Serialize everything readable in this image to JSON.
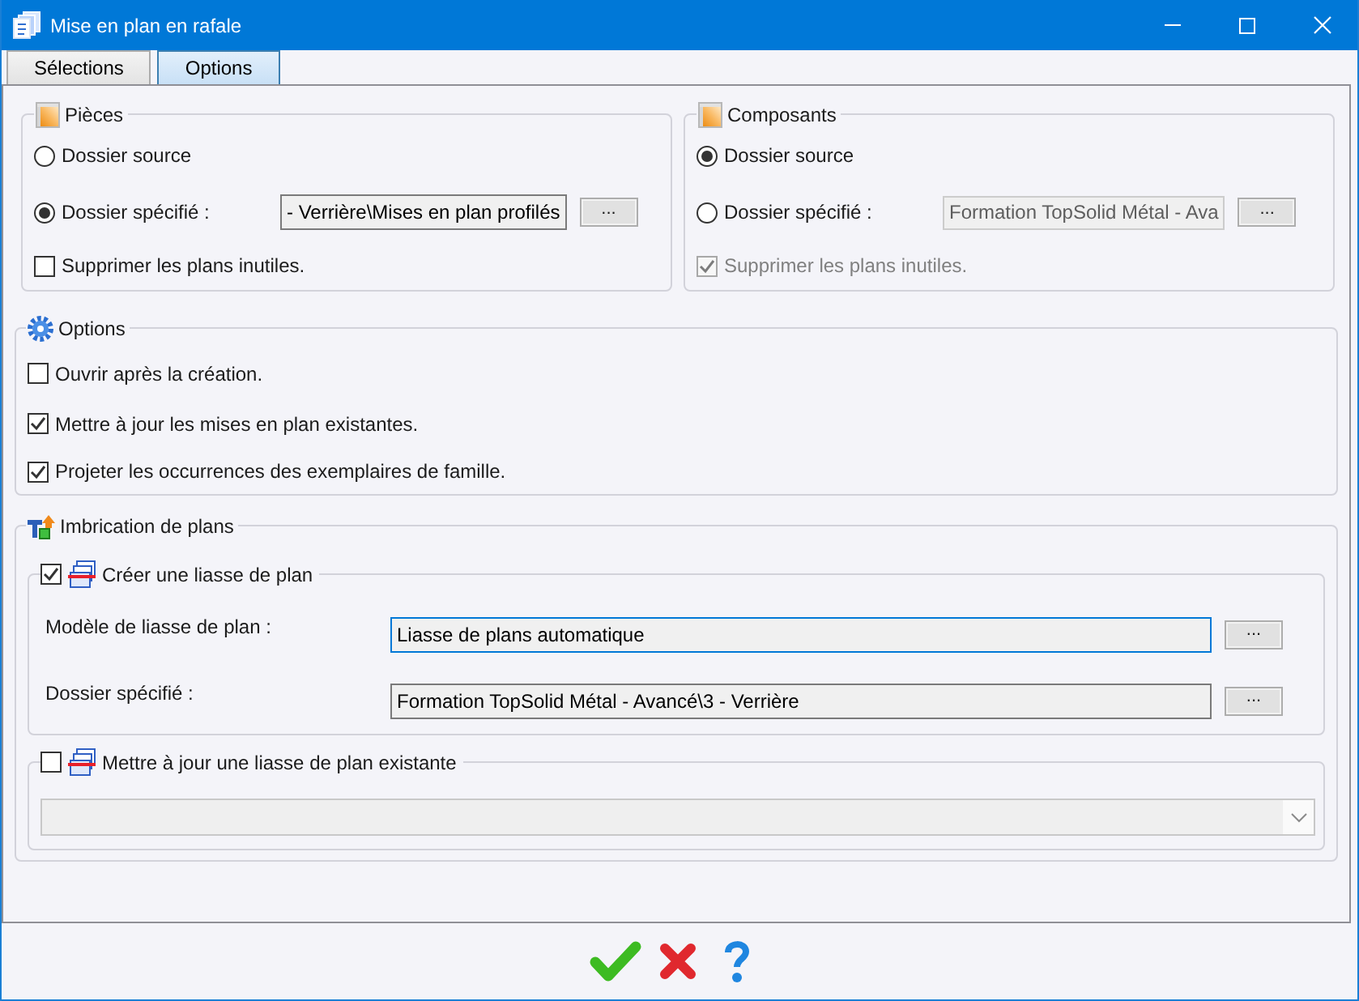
{
  "window": {
    "title": "Mise en plan en rafale"
  },
  "tabs": [
    {
      "label": "Sélections",
      "selected": false
    },
    {
      "label": "Options",
      "selected": true
    }
  ],
  "source_groups": [
    {
      "title": "Pièces",
      "options": [
        {
          "label": "Dossier source",
          "selected": false
        },
        {
          "label": "Dossier spécifié :",
          "selected": true,
          "folder_field": {
            "value": "- Verrière\\Mises en plan profilés",
            "disabled": false
          },
          "browse_button": "..."
        }
      ],
      "delete_unused": {
        "label": "Supprimer les plans inutiles.",
        "checked": false,
        "disabled": false
      }
    },
    {
      "title": "Composants",
      "options": [
        {
          "label": "Dossier source",
          "selected": true
        },
        {
          "label": "Dossier spécifié :",
          "selected": false,
          "folder_field": {
            "value": "Formation TopSolid Métal - Ava",
            "disabled": true
          },
          "browse_button": "..."
        }
      ],
      "delete_unused": {
        "label": "Supprimer les plans inutiles.",
        "checked": true,
        "disabled": true
      }
    }
  ],
  "options": {
    "title": "Options",
    "checkboxes": [
      {
        "label": "Ouvrir après la création.",
        "checked": false
      },
      {
        "label": "Mettre à jour les mises en plan existantes.",
        "checked": true
      },
      {
        "label": "Projeter les occurrences des exemplaires de famille.",
        "checked": true
      }
    ]
  },
  "nesting": {
    "title": "Imbrication de plans",
    "create_bundle": {
      "label": "Créer une liasse de plan",
      "checked": true,
      "fields": [
        {
          "label": "Modèle de liasse de plan :",
          "value": "Liasse de plans automatique",
          "focused": true,
          "browse_button": "..."
        },
        {
          "label": "Dossier spécifié :",
          "value": "Formation TopSolid Métal - Avancé\\3 - Verrière",
          "focused": false,
          "browse_button": "..."
        }
      ]
    },
    "update_bundle": {
      "label": "Mettre à jour une liasse de plan existante",
      "checked": false,
      "dropdown": {
        "disabled": true
      }
    }
  },
  "footer_buttons": [
    {
      "kind": "ok"
    },
    {
      "kind": "cancel"
    },
    {
      "kind": "help"
    }
  ]
}
